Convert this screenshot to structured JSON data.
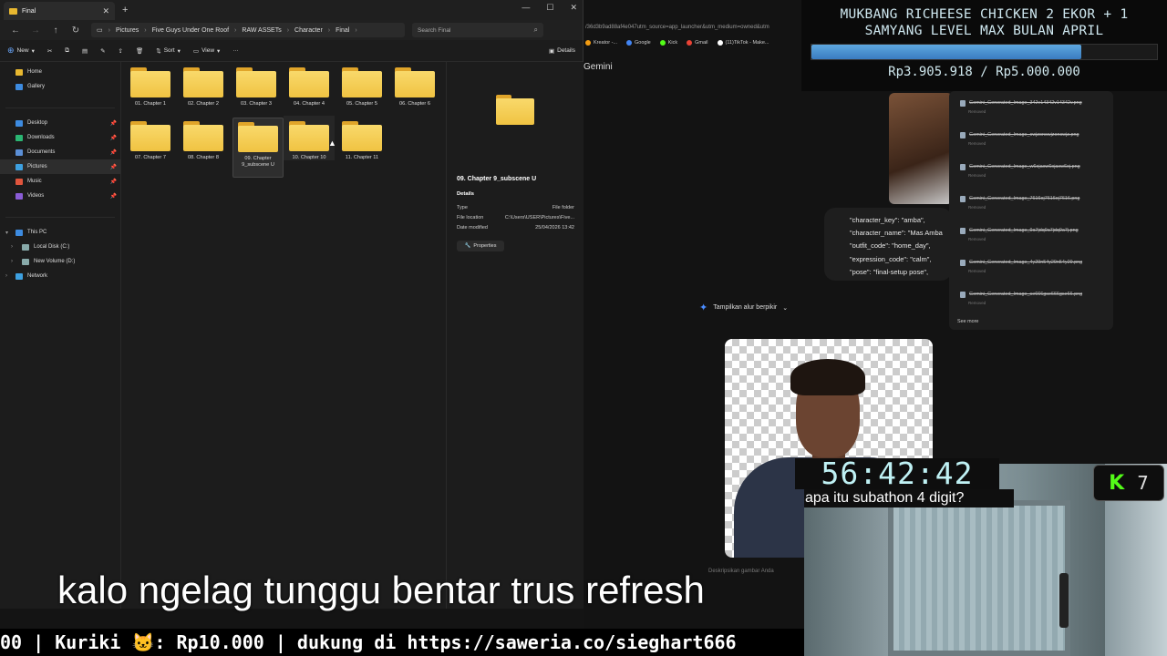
{
  "explorer": {
    "tab_title": "Final",
    "breadcrumbs": [
      "Pictures",
      "Five Guys Under One Roof",
      "RAW ASSETs",
      "Character",
      "Final"
    ],
    "search_placeholder": "Search Final",
    "commands": {
      "new": "New",
      "sort": "Sort",
      "view": "View",
      "details": "Details"
    },
    "sidebar": {
      "quick": [
        {
          "label": "Home",
          "color": "#e8b830"
        },
        {
          "label": "Gallery",
          "color": "#3d8be0"
        }
      ],
      "pinned": [
        {
          "label": "Desktop",
          "color": "#3d8be0"
        },
        {
          "label": "Downloads",
          "color": "#2bb673"
        },
        {
          "label": "Documents",
          "color": "#5b8fd6"
        },
        {
          "label": "Pictures",
          "color": "#3da0e0"
        },
        {
          "label": "Music",
          "color": "#e0553d"
        },
        {
          "label": "Videos",
          "color": "#8a5cd6"
        }
      ],
      "this_pc": "This PC",
      "drives": [
        "Local Disk (C:)",
        "New Volume (D:)"
      ],
      "network": "Network"
    },
    "folders": [
      "01. Chapter 1",
      "02. Chapter 2",
      "03. Chapter 3",
      "04. Chapter 4",
      "05. Chapter 5",
      "06. Chapter 6",
      "07. Chapter 7",
      "08. Chapter 8",
      "09. Chapter 9_subscene U",
      "10. Chapter 10",
      "11. Chapter 11"
    ],
    "details": {
      "name": "09. Chapter 9_subscene U",
      "section": "Details",
      "rows": [
        {
          "k": "Type",
          "v": "File folder"
        },
        {
          "k": "File location",
          "v": "C:\\Users\\USER\\Pictures\\Five..."
        },
        {
          "k": "Date modified",
          "v": "25/04/2026 13:42"
        }
      ],
      "properties": "Properties"
    }
  },
  "browser": {
    "url": "/36d3b9ad88af4e047utm_source=app_launcher&utm_medium=owned&utm",
    "bookmarks": [
      {
        "label": "Kreator -...",
        "color": "#f39c12"
      },
      {
        "label": "Google",
        "color": "#4285f4"
      },
      {
        "label": "Kick",
        "color": "#53fc18"
      },
      {
        "label": "Gmail",
        "color": "#ea4335"
      },
      {
        "label": "(11)TikTok - Make...",
        "color": "#ffffff"
      }
    ],
    "app_title": "Gemini",
    "code_lines": [
      "\"character_key\": \"amba\",",
      "\"character_name\": \"Mas Amba",
      "\"outfit_code\": \"home_day\",",
      "\"expression_code\": \"calm\",",
      "\"pose\": \"final-setup pose\","
    ],
    "files": [
      "Gemini_Generated_Image_342v14342v14342v.png",
      "Gemini_Generated_Image_cwjzoncwjzoncwjz.png",
      "Gemini_Generated_Image_w6ojaxw6ojaxw6oj.png",
      "Gemini_Generated_Image_7616oj7616oj7616.png",
      "Gemini_Generated_Image_9a7jdq9a7jdq9a7j.png",
      "Gemini_Generated_Image_4y29n54y29n54y29.png",
      "Gemini_Generated_Image_se666gse666gse66.png"
    ],
    "file_status": "Removed",
    "see_more": "See more",
    "thinking": "Tampilkan alur berpikir",
    "describe": "Deskripsikan gambar Anda"
  },
  "overlay": {
    "goal_title_1": "MUKBANG RICHEESE CHICKEN 2 EKOR + 1",
    "goal_title_2": "SAMYANG LEVEL MAX BULAN APRIL",
    "goal_amount": "Rp3.905.918 / Rp5.000.000",
    "goal_progress": 0.78,
    "goal_color": "#4a90d9",
    "timer": "56:42:42",
    "question": "apa itu subathon 4 digit?",
    "kick_count": "7",
    "kick_logo": "K",
    "subtitle": "kalo ngelag tunggu bentar trus refresh",
    "ticker": "00 | Kuriki 🐱: Rp10.000 |  dukung di https://saweria.co/sieghart666"
  }
}
